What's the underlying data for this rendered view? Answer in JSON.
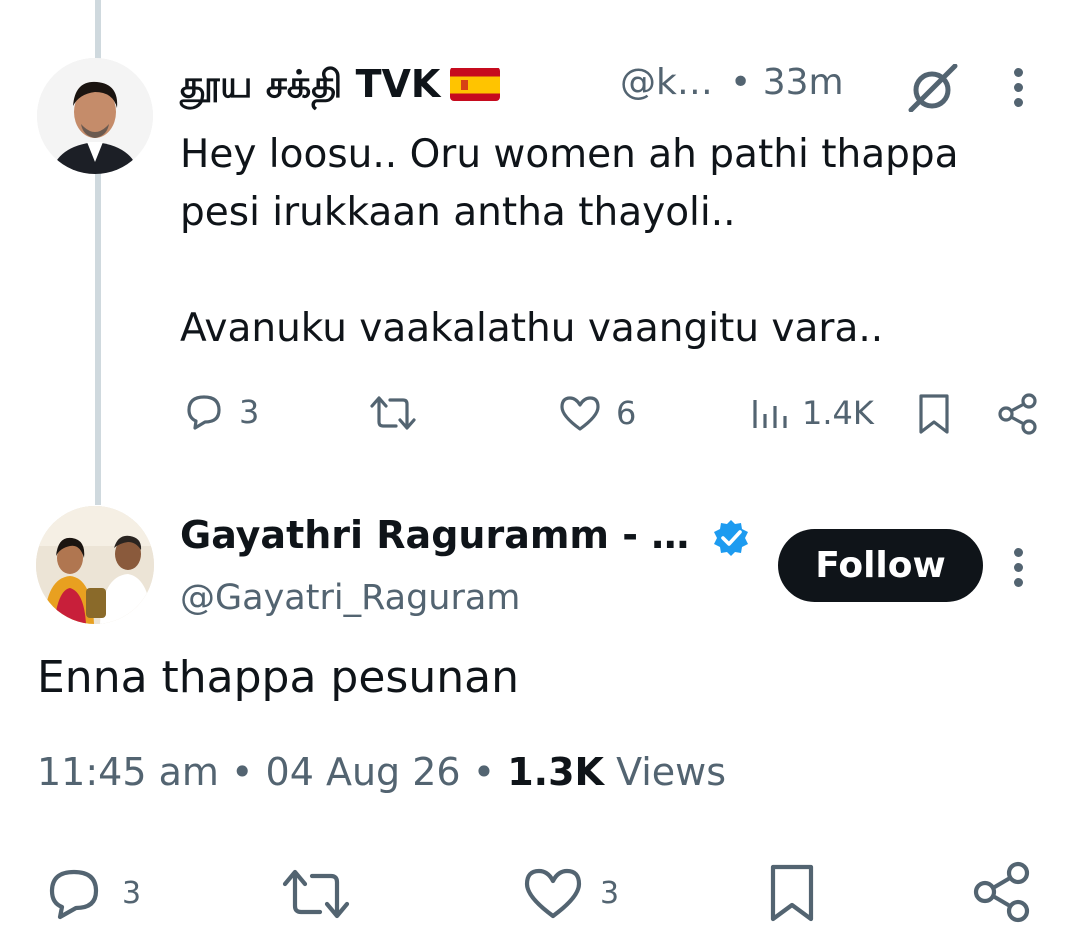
{
  "reply": {
    "display_name": "தூய சக்தி TVK",
    "flag_icon": "spain-flag-emoji",
    "handle": "@k…",
    "separator": "•",
    "time": "33m",
    "text": "Hey loosu.. Oru women ah pathi thappa\npesi irukkaan antha thayoli..\n\nAvanuku vaakalathu vaangitu vara..",
    "actions": {
      "replies": "3",
      "reposts": "",
      "likes": "6",
      "views": "1.4K"
    }
  },
  "main": {
    "display_name": "Gayathri Raguramm - …",
    "verified_icon": "verified-badge-icon",
    "handle": "@Gayatri_Raguram",
    "follow_label": "Follow",
    "text": "Enna thappa pesunan",
    "time": "11:45 am",
    "date": "04 Aug 26",
    "sep": "•",
    "views_count": "1.3K",
    "views_label": "Views",
    "actions": {
      "replies": "3",
      "reposts": "",
      "likes": "3"
    }
  },
  "colors": {
    "text": "#0f1419",
    "secondary": "#536471",
    "thread_line": "#cfd9de",
    "verified": "#1d9bf0",
    "follow_bg": "#0f1419"
  }
}
